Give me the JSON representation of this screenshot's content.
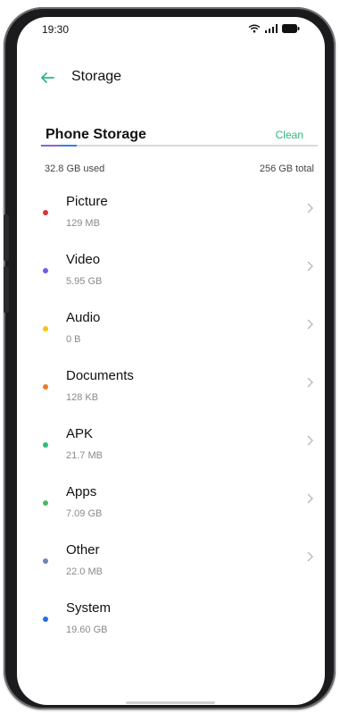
{
  "status_bar": {
    "time": "19:30"
  },
  "header": {
    "title": "Storage"
  },
  "storage": {
    "section_title": "Phone Storage",
    "action_label": "Clean",
    "used_label": "32.8 GB used",
    "total_label": "256 GB total",
    "used_fraction": 0.128,
    "segment_colors": [
      "#8a63d2",
      "#3b7ee6"
    ]
  },
  "items": [
    {
      "label": "Picture",
      "size": "129 MB",
      "color": "#e0323c"
    },
    {
      "label": "Video",
      "size": "5.95 GB",
      "color": "#7a57e8"
    },
    {
      "label": "Audio",
      "size": "0 B",
      "color": "#f3c319"
    },
    {
      "label": "Documents",
      "size": "128 KB",
      "color": "#f07a2a"
    },
    {
      "label": "APK",
      "size": "21.7 MB",
      "color": "#2fbf7b"
    },
    {
      "label": "Apps",
      "size": "7.09 GB",
      "color": "#4cb86a"
    },
    {
      "label": "Other",
      "size": "22.0 MB",
      "color": "#6d85b9"
    },
    {
      "label": "System",
      "size": "19.60 GB",
      "color": "#1f6fe0"
    }
  ],
  "icons": {
    "back": "arrow-left-icon",
    "wifi": "wifi-icon",
    "signal": "signal-icon",
    "battery": "battery-icon",
    "chevron": "chevron-right-icon"
  },
  "colors": {
    "accent": "#2fb67d",
    "text_primary": "#111111",
    "text_secondary": "#8a8a8a"
  }
}
